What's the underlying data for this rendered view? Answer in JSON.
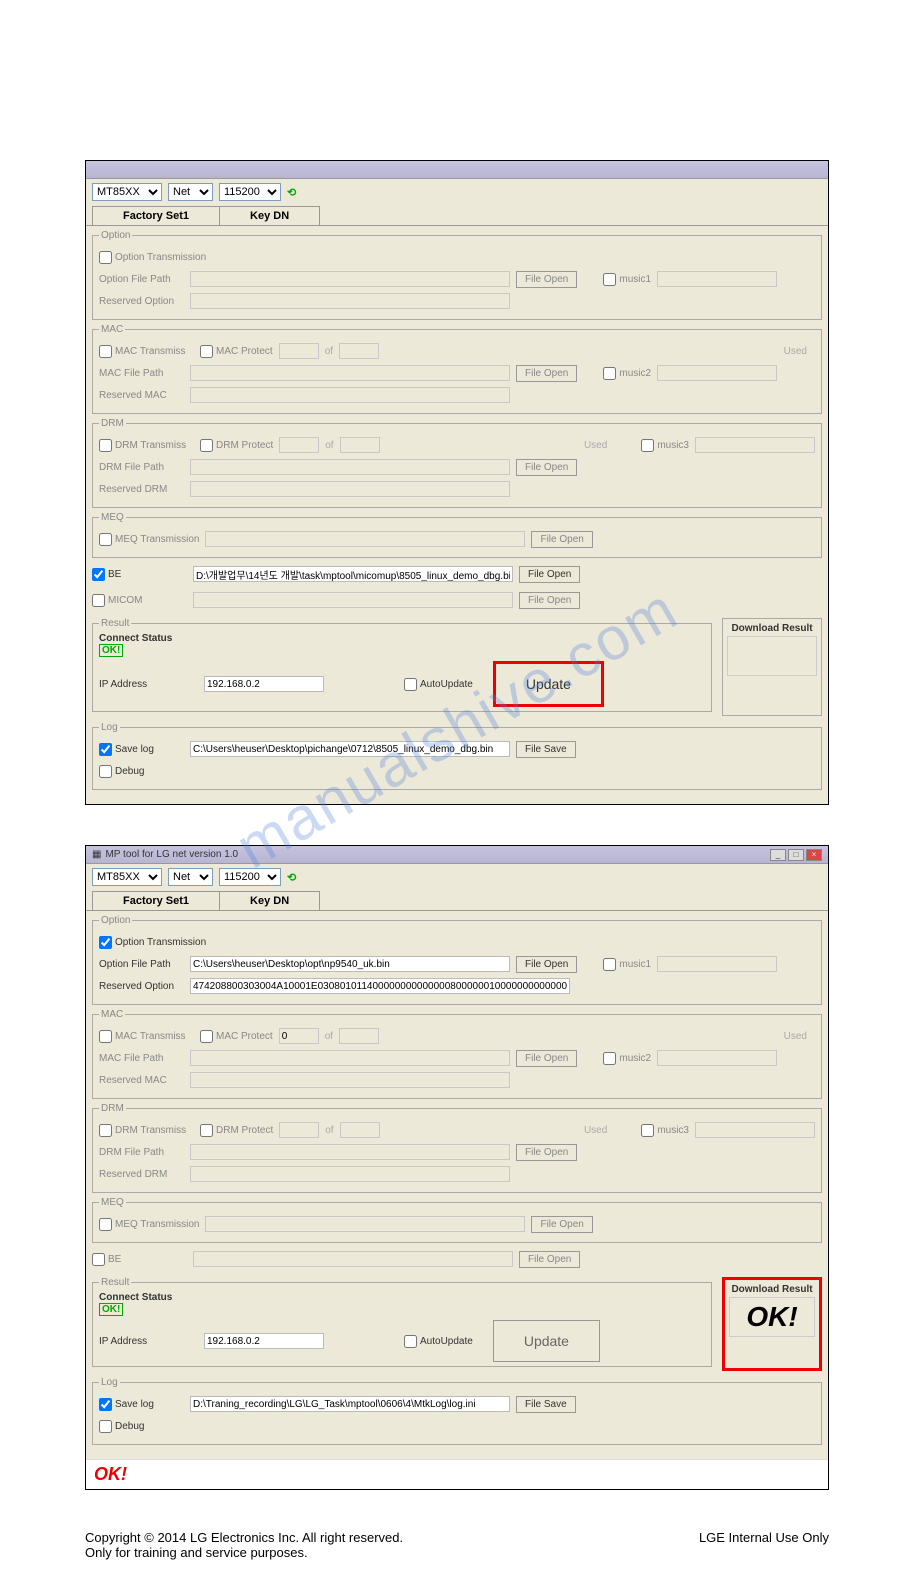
{
  "watermark": "manualshive.com",
  "app1": {
    "title": "",
    "toolbar": {
      "model": "MT85XX",
      "conn": "Net",
      "baud": "115200"
    },
    "tabs": {
      "factory": "Factory Set1",
      "keydn": "Key DN"
    },
    "option": {
      "legend": "Option",
      "transmission": "Option Transmission",
      "file_path_lbl": "Option File Path",
      "file_path": "",
      "reserved_lbl": "Reserved Option",
      "reserved": "",
      "file_open": "File Open",
      "music1": "music1"
    },
    "mac": {
      "legend": "MAC",
      "transmiss": "MAC Transmiss",
      "protect": "MAC Protect",
      "of": "of",
      "used": "Used",
      "file_path_lbl": "MAC File Path",
      "reserved_lbl": "Reserved MAC",
      "file_open": "File Open",
      "music2": "music2"
    },
    "drm": {
      "legend": "DRM",
      "transmiss": "DRM Transmiss",
      "protect": "DRM Protect",
      "of": "of",
      "used": "Used",
      "file_path_lbl": "DRM File Path",
      "reserved_lbl": "Reserved DRM",
      "file_open": "File Open",
      "music3": "music3"
    },
    "meq": {
      "legend": "MEQ",
      "transmission": "MEQ Transmission",
      "file_open": "File Open"
    },
    "be": {
      "label": "BE",
      "path": "D:\\개발업무\\14년도 개발\\task\\mptool\\micomup\\8505_linux_demo_dbg.bin",
      "file_open": "File Open"
    },
    "micom": {
      "label": "MICOM",
      "file_open": "File Open"
    },
    "result": {
      "legend": "Result",
      "connect_status_lbl": "Connect Status",
      "ok": "OK!",
      "ip_lbl": "IP Address",
      "ip": "192.168.0.2",
      "auto_update": "AutoUpdate",
      "update": "Update",
      "dl_result_lbl": "Download Result"
    },
    "log": {
      "legend": "Log",
      "save_log": "Save log",
      "path": "C:\\Users\\heuser\\Desktop\\pichange\\0712\\8505_linux_demo_dbg.bin",
      "file_save": "File Save",
      "debug": "Debug"
    }
  },
  "app2": {
    "title": "MP tool for LG net version 1.0",
    "toolbar": {
      "model": "MT85XX",
      "conn": "Net",
      "baud": "115200"
    },
    "tabs": {
      "factory": "Factory Set1",
      "keydn": "Key DN"
    },
    "option": {
      "legend": "Option",
      "transmission": "Option Transmission",
      "file_path_lbl": "Option File Path",
      "file_path": "C:\\Users\\heuser\\Desktop\\opt\\np9540_uk.bin",
      "reserved_lbl": "Reserved Option",
      "reserved": "474208800303004A10001E030801011400000000000000800000010000000000000",
      "file_open": "File Open",
      "music1": "music1"
    },
    "mac": {
      "legend": "MAC",
      "transmiss": "MAC Transmiss",
      "protect": "MAC Protect",
      "count1": "0",
      "of": "of",
      "used": "Used",
      "file_path_lbl": "MAC File Path",
      "reserved_lbl": "Reserved MAC",
      "file_open": "File Open",
      "music2": "music2"
    },
    "drm": {
      "legend": "DRM",
      "transmiss": "DRM Transmiss",
      "protect": "DRM Protect",
      "of": "of",
      "used": "Used",
      "file_path_lbl": "DRM File Path",
      "reserved_lbl": "Reserved DRM",
      "file_open": "File Open",
      "music3": "music3"
    },
    "meq": {
      "legend": "MEQ",
      "transmission": "MEQ Transmission",
      "file_open": "File Open"
    },
    "be": {
      "label": "BE",
      "file_open": "File Open"
    },
    "result": {
      "legend": "Result",
      "connect_status_lbl": "Connect Status",
      "ok": "OK!",
      "ip_lbl": "IP Address",
      "ip": "192.168.0.2",
      "auto_update": "AutoUpdate",
      "update": "Update",
      "dl_result_lbl": "Download Result",
      "dl_ok": "OK!"
    },
    "log": {
      "legend": "Log",
      "save_log": "Save log",
      "path": "D:\\Traning_recording\\LG\\LG_Task\\mptool\\0606\\4\\MtkLog\\log.ini",
      "file_save": "File Save",
      "debug": "Debug"
    },
    "bottom_ok": "OK!"
  },
  "footer": {
    "left1": "Copyright © 2014 LG Electronics Inc. All right reserved.",
    "left2": "Only for training and service purposes.",
    "right": "LGE Internal Use Only"
  }
}
